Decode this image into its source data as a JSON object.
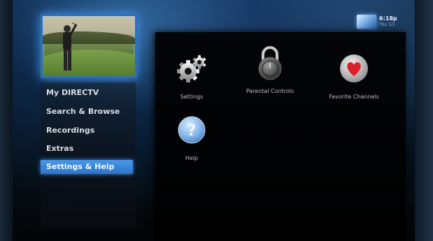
{
  "header": {
    "clock_time": "6:18p",
    "clock_day": "Thu 1/1"
  },
  "preview": {
    "alt": "golf broadcast"
  },
  "menu": {
    "items": [
      {
        "label": "My DIRECTV",
        "selected": false
      },
      {
        "label": "Search & Browse",
        "selected": false
      },
      {
        "label": "Recordings",
        "selected": false
      },
      {
        "label": "Extras",
        "selected": false
      },
      {
        "label": "Settings & Help",
        "selected": true
      }
    ]
  },
  "tiles": [
    {
      "label": "Settings",
      "icon": "gears-icon"
    },
    {
      "label": "Parental Controls",
      "icon": "padlock-icon"
    },
    {
      "label": "Favorite Channels",
      "icon": "heart-icon"
    },
    {
      "label": "Help",
      "icon": "question-icon"
    }
  ],
  "colors": {
    "accent": "#2d74c9",
    "heart": "#d8232a",
    "help": "#4a8fd6"
  }
}
